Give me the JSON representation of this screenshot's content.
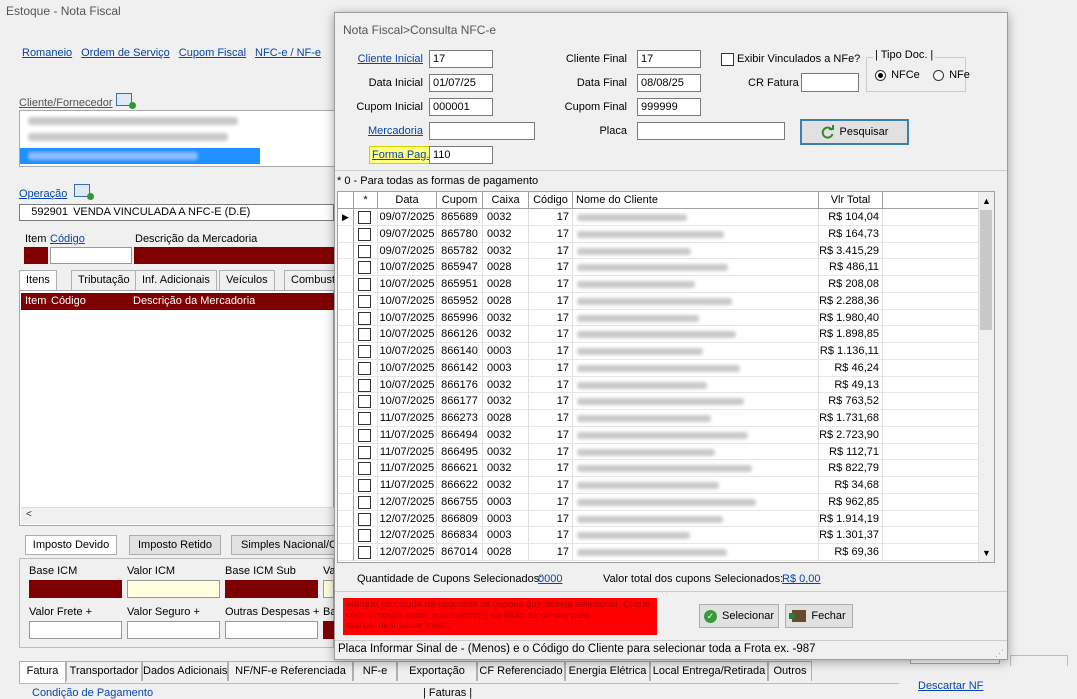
{
  "app": {
    "title": "Estoque - Nota Fiscal"
  },
  "topnav": [
    "Romaneio",
    "Ordem de Serviço",
    "Cupom Fiscal",
    "NFC-e / NF-e"
  ],
  "main": {
    "cliente_label": "Cliente/Fornecedor",
    "operacao_label": "Operação",
    "operacao_code": "592901",
    "operacao_desc": "VENDA VINCULADA A NFC-E (D.E)",
    "item_label": "Item",
    "codigo_label": "Código",
    "descricao_label": "Descrição da Mercadoria",
    "tabs": [
      "Itens",
      "Tributação",
      "Inf. Adicionais",
      "Veículos",
      "Combusti"
    ],
    "grid_headers": [
      "Item",
      "Código",
      "Descrição da Mercadoria"
    ],
    "imposto_buttons": [
      "Imposto Devido",
      "Imposto Retido",
      "Simples Nacional/O"
    ],
    "tax_labels": [
      "Base ICM",
      "Valor ICM",
      "Base ICM Sub",
      "Va"
    ],
    "tax_labels2": [
      "Valor Frete +",
      "Valor Seguro +",
      "Outras Despesas +",
      "Ba"
    ],
    "bottom_tabs": [
      "Fatura",
      "Transportador",
      "Dados Adicionais",
      "NF/NF-e Referenciada",
      "NF-e",
      "Exportação",
      "CF Referenciado",
      "Energia Elétrica",
      "Local Entrega/Retirada",
      "Outros"
    ],
    "condicao": "Condição de Pagamento",
    "faturas": "| Faturas |",
    "descartar": "Descartar NF"
  },
  "dialog": {
    "title": "Nota Fiscal>Consulta NFC-e",
    "cliente_inicial_label": "Cliente Inicial",
    "cliente_inicial": "17",
    "cliente_final_label": "Cliente Final",
    "cliente_final": "17",
    "exibir_label": "Exibir Vinculados a NFe?",
    "tipo_doc_label": "| Tipo Doc. |",
    "nfce_label": "NFCe",
    "nfe_label": "NFe",
    "data_inicial_label": "Data Inicial",
    "data_inicial": "01/07/25",
    "data_final_label": "Data Final",
    "data_final": "08/08/25",
    "cr_fatura_label": "CR Fatura",
    "cr_fatura": "",
    "cupom_inicial_label": "Cupom Inicial",
    "cupom_inicial": "000001",
    "cupom_final_label": "Cupom Final",
    "cupom_final": "999999",
    "mercadoria_label": "Mercadoria",
    "mercadoria": "",
    "placa_label": "Placa",
    "placa": "",
    "pesquisar_label": "Pesquisar",
    "forma_pag_label": "Forma Pag.",
    "forma_pag": "110",
    "hint": "* 0 - Para todas as formas de pagamento",
    "columns": [
      "*",
      "Data",
      "Cupom",
      "Caixa",
      "Código",
      "Nome do Cliente",
      "Vlr Total"
    ],
    "rows": [
      {
        "data": "09/07/2025",
        "cupom": "865689",
        "caixa": "0032",
        "codigo": "17",
        "valor": "R$ 104,04"
      },
      {
        "data": "09/07/2025",
        "cupom": "865780",
        "caixa": "0032",
        "codigo": "17",
        "valor": "R$ 164,73"
      },
      {
        "data": "09/07/2025",
        "cupom": "865782",
        "caixa": "0032",
        "codigo": "17",
        "valor": "R$ 3.415,29"
      },
      {
        "data": "10/07/2025",
        "cupom": "865947",
        "caixa": "0028",
        "codigo": "17",
        "valor": "R$ 486,11"
      },
      {
        "data": "10/07/2025",
        "cupom": "865951",
        "caixa": "0028",
        "codigo": "17",
        "valor": "R$ 208,08"
      },
      {
        "data": "10/07/2025",
        "cupom": "865952",
        "caixa": "0028",
        "codigo": "17",
        "valor": "R$ 2.288,36"
      },
      {
        "data": "10/07/2025",
        "cupom": "865996",
        "caixa": "0032",
        "codigo": "17",
        "valor": "R$ 1.980,40"
      },
      {
        "data": "10/07/2025",
        "cupom": "866126",
        "caixa": "0032",
        "codigo": "17",
        "valor": "R$ 1.898,85"
      },
      {
        "data": "10/07/2025",
        "cupom": "866140",
        "caixa": "0003",
        "codigo": "17",
        "valor": "R$ 1.136,11"
      },
      {
        "data": "10/07/2025",
        "cupom": "866142",
        "caixa": "0003",
        "codigo": "17",
        "valor": "R$ 46,24"
      },
      {
        "data": "10/07/2025",
        "cupom": "866176",
        "caixa": "0032",
        "codigo": "17",
        "valor": "R$ 49,13"
      },
      {
        "data": "10/07/2025",
        "cupom": "866177",
        "caixa": "0032",
        "codigo": "17",
        "valor": "R$ 763,52"
      },
      {
        "data": "11/07/2025",
        "cupom": "866273",
        "caixa": "0028",
        "codigo": "17",
        "valor": "R$ 1.731,68"
      },
      {
        "data": "11/07/2025",
        "cupom": "866494",
        "caixa": "0032",
        "codigo": "17",
        "valor": "R$ 2.723,90"
      },
      {
        "data": "11/07/2025",
        "cupom": "866495",
        "caixa": "0032",
        "codigo": "17",
        "valor": "R$ 112,71"
      },
      {
        "data": "11/07/2025",
        "cupom": "866621",
        "caixa": "0032",
        "codigo": "17",
        "valor": "R$ 822,79"
      },
      {
        "data": "11/07/2025",
        "cupom": "866622",
        "caixa": "0032",
        "codigo": "17",
        "valor": "R$ 34,68"
      },
      {
        "data": "12/07/2025",
        "cupom": "866755",
        "caixa": "0003",
        "codigo": "17",
        "valor": "R$ 962,85"
      },
      {
        "data": "12/07/2025",
        "cupom": "866809",
        "caixa": "0003",
        "codigo": "17",
        "valor": "R$ 1.914,19"
      },
      {
        "data": "12/07/2025",
        "cupom": "866834",
        "caixa": "0003",
        "codigo": "17",
        "valor": "R$ 1.301,37"
      },
      {
        "data": "12/07/2025",
        "cupom": "867014",
        "caixa": "0028",
        "codigo": "17",
        "valor": "R$ 69,36"
      }
    ],
    "qtd_label": "Quantidade de Cupons Selecionados:",
    "qtd_value": "0000",
    "total_label": "Valor total dos cupons Selecionados:",
    "total_value": "R$ 0,00",
    "warning": "Marque na coluna da esquerda os cupons que deseja selecionar. Clique com o mouse sobre o asterisco(*) no título da coluna para marcar/desmarcar todos.",
    "selecionar_label": "Selecionar",
    "fechar_label": "Fechar",
    "status": "Placa Informar Sinal de - (Menos)  e o Código do Cliente para selecionar toda a Frota ex. -987",
    "colors": {
      "warning_bg": "#ff0000",
      "header_red": "#7f0000",
      "highlight": "#ffff80",
      "selected_blue": "#1e90ff"
    }
  }
}
